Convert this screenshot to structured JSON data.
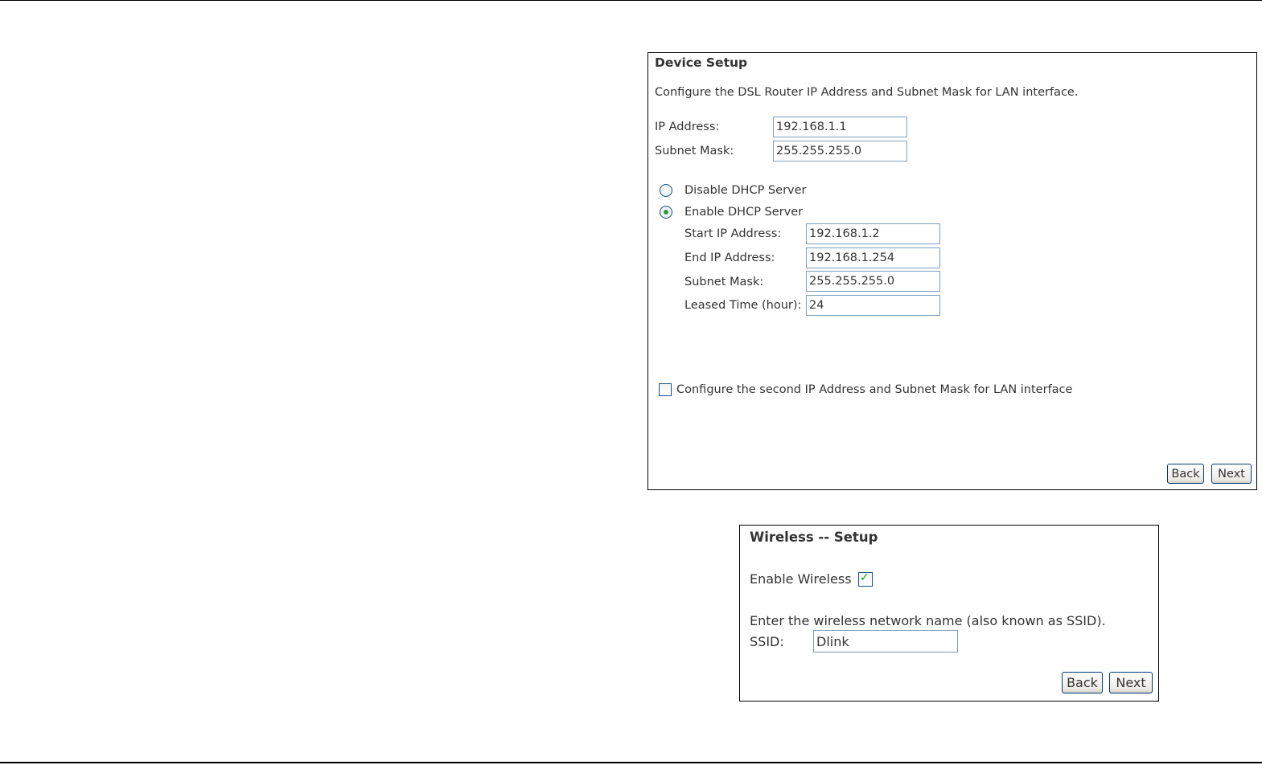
{
  "device_setup": {
    "title": "Device Setup",
    "description": "Configure the DSL Router IP Address and Subnet Mask for LAN interface.",
    "ip_address_label": "IP Address:",
    "ip_address_value": "192.168.1.1",
    "subnet_mask_label": "Subnet Mask:",
    "subnet_mask_value": "255.255.255.0",
    "disable_dhcp_label": "Disable DHCP Server",
    "enable_dhcp_label": "Enable DHCP Server",
    "dhcp_selected": "enable",
    "start_ip_label": "Start IP Address:",
    "start_ip_value": "192.168.1.2",
    "end_ip_label": "End IP Address:",
    "end_ip_value": "192.168.1.254",
    "dhcp_subnet_label": "Subnet Mask:",
    "dhcp_subnet_value": "255.255.255.0",
    "leased_time_label": "Leased Time (hour):",
    "leased_time_value": "24",
    "second_ip_label": "Configure the second IP Address and Subnet Mask for LAN interface",
    "second_ip_checked": false,
    "back_label": "Back",
    "next_label": "Next"
  },
  "wireless_setup": {
    "title": "Wireless -- Setup",
    "enable_wireless_label": "Enable Wireless",
    "enable_wireless_checked": true,
    "ssid_description": "Enter the wireless network name (also known as SSID).",
    "ssid_label": "SSID:",
    "ssid_value": "Dlink",
    "back_label": "Back",
    "next_label": "Next"
  },
  "colors": {
    "field_border": "#7f9db9",
    "radio_dot": "#2f9b2f",
    "check_tick": "#21a121",
    "button_border": "#003c74"
  }
}
